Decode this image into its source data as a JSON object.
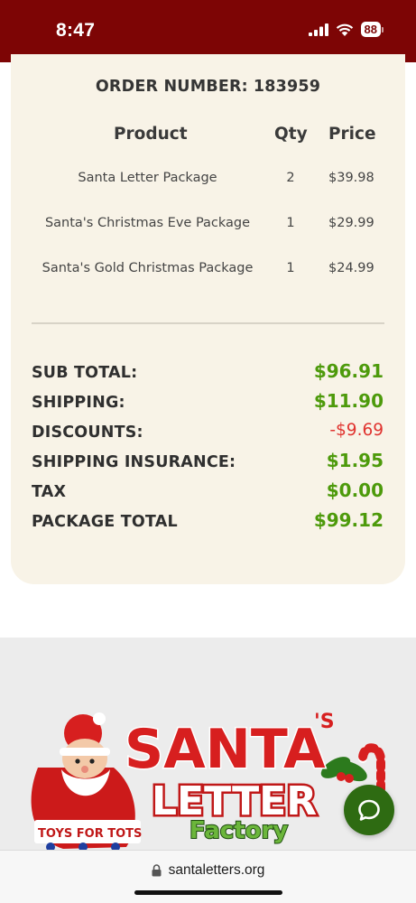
{
  "status_bar": {
    "time": "8:47",
    "battery": "88",
    "icons": [
      "signal-icon",
      "wifi-icon",
      "battery-icon"
    ]
  },
  "order": {
    "number_label": "ORDER NUMBER:",
    "number": "183959",
    "columns": {
      "product": "Product",
      "qty": "Qty",
      "price": "Price"
    },
    "items": [
      {
        "product": "Santa Letter Package",
        "qty": "2",
        "price": "$39.98"
      },
      {
        "product": "Santa's Christmas Eve Package",
        "qty": "1",
        "price": "$29.99"
      },
      {
        "product": "Santa's Gold Christmas Package",
        "qty": "1",
        "price": "$24.99"
      }
    ],
    "totals": [
      {
        "label": "SUB TOTAL:",
        "value": "$96.91",
        "kind": "positive"
      },
      {
        "label": "SHIPPING:",
        "value": "$11.90",
        "kind": "positive"
      },
      {
        "label": "DISCOUNTS:",
        "value": "-$9.69",
        "kind": "negative"
      },
      {
        "label": "SHIPPING INSURANCE:",
        "value": "$1.95",
        "kind": "positive"
      },
      {
        "label": "TAX",
        "value": "$0.00",
        "kind": "positive"
      },
      {
        "label": "PACKAGE TOTAL",
        "value": "$99.12",
        "kind": "positive"
      }
    ]
  },
  "footer": {
    "logo": {
      "santa": "SANTA",
      "apostrophe": "'S",
      "letter": "LETTER",
      "factory": "Factory",
      "toys": "TOYS FOR TOTS"
    },
    "chat_icon": "chat-bubble-icon"
  },
  "browser": {
    "url": "santaletters.org",
    "lock_icon": "lock-icon"
  },
  "colors": {
    "header": "#7d0505",
    "card_background": "#f8f3e7",
    "positive": "#4d9a0b",
    "negative": "#e0332f",
    "footer_band": "#ececec",
    "chat_button": "#2e6b12"
  }
}
